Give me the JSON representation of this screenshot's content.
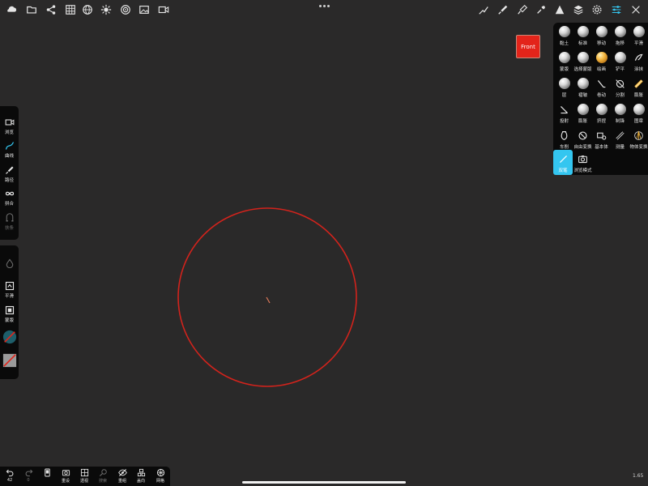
{
  "colors": {
    "background": "#2a2929",
    "panel": "#0a0a0a",
    "accent_active": "#34c6f0",
    "front_button": "#e3241a",
    "circle_stroke": "#d3231c"
  },
  "topbar": {
    "left_icons": [
      "cloud-icon",
      "folder-icon",
      "share-icon",
      "grid-icon",
      "globe-icon",
      "sun-icon",
      "target-icon",
      "image-icon",
      "video-camera-icon"
    ],
    "right_icons": [
      "stroke-tool-icon",
      "brush-icon",
      "paint-icon",
      "pipette-icon",
      "cone-icon",
      "layers-icon",
      "gear-icon",
      "sliders-icon",
      "tools-menu-icon"
    ]
  },
  "front_button": {
    "label": "Front"
  },
  "tool_panel": {
    "rows": [
      [
        "黏土",
        "标准",
        "移动",
        "拖移",
        "平滑"
      ],
      [
        "蒙版",
        "选择蒙版",
        "绘画",
        "铲平",
        "涂抹"
      ],
      [
        "层",
        "褶皱",
        "卷动",
        "分割",
        "膨胀"
      ],
      [
        "投射",
        "膨胀",
        "挤捏",
        "制锋",
        "图章"
      ],
      [
        "车削",
        "自由变换",
        "基本体",
        "测量",
        "物体变换"
      ]
    ],
    "bottom_row": [
      "双笔",
      "浏览模式"
    ],
    "active": "双笔"
  },
  "left_panel_top": {
    "items": [
      {
        "label": "浏览",
        "icon": "video-camera-icon"
      },
      {
        "label": "曲线",
        "icon": "curve-icon"
      },
      {
        "label": "路径",
        "icon": "stroke-path-icon"
      },
      {
        "label": "拼合",
        "icon": "infinity-icon"
      },
      {
        "label": "扶条",
        "icon": "handles-icon"
      }
    ]
  },
  "left_panel_bottom": {
    "items": [
      {
        "label": "",
        "icon": "droplet-icon"
      },
      {
        "label": "平滑",
        "icon": "smooth-icon"
      },
      {
        "label": "蒙版",
        "icon": "mask-icon"
      },
      {
        "label": "",
        "icon": "color-swatch-icon"
      },
      {
        "label": "",
        "icon": "material-swatch-icon"
      }
    ]
  },
  "bottombar": {
    "items": [
      {
        "label": "42",
        "icon": "undo-icon"
      },
      {
        "label": "0",
        "icon": "redo-icon"
      },
      {
        "label": "",
        "icon": "phone-icon"
      },
      {
        "label": "重设",
        "icon": "camera-reset-icon"
      },
      {
        "label": "透视",
        "icon": "perspective-icon"
      },
      {
        "label": "搜索",
        "icon": "magnify-icon"
      },
      {
        "label": "重组",
        "icon": "eye-off-icon"
      },
      {
        "label": "盖向",
        "icon": "stack-icon"
      },
      {
        "label": "网格",
        "icon": "wireframe-icon"
      }
    ]
  },
  "version": "1.65"
}
